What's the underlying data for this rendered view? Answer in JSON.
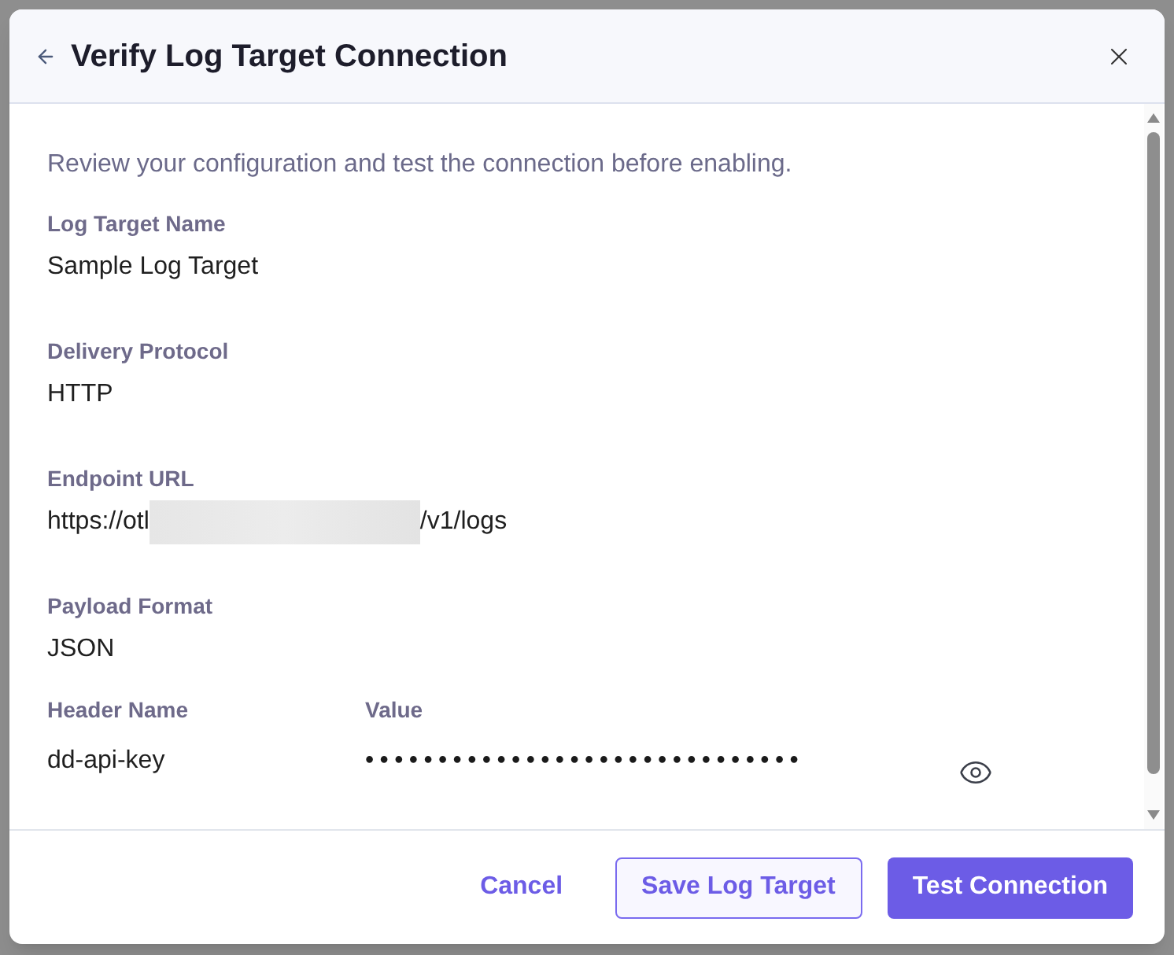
{
  "dialog": {
    "title": "Verify Log Target Connection"
  },
  "intro": "Review your configuration and test the connection before enabling.",
  "fields": [
    {
      "kind": "plain",
      "label": "Log Target Name",
      "value": "Sample Log Target"
    },
    {
      "kind": "plain",
      "label": "Delivery Protocol",
      "value": "HTTP"
    },
    {
      "kind": "redacted",
      "label": "Endpoint URL",
      "value_before": "https://otl",
      "value_after": "/v1/logs"
    },
    {
      "kind": "plain",
      "label": "Payload Format",
      "value": "JSON"
    }
  ],
  "headers": {
    "columns": [
      "Header Name",
      "Value"
    ],
    "rows": [
      {
        "name": "dd-api-key",
        "value": "••••••••••••••••••••••••••••••"
      }
    ]
  },
  "buttons": [
    {
      "kind": "text",
      "label": "Cancel"
    },
    {
      "kind": "outline",
      "label": "Save Log Target"
    },
    {
      "kind": "primary",
      "label": "Test Connection"
    }
  ]
}
